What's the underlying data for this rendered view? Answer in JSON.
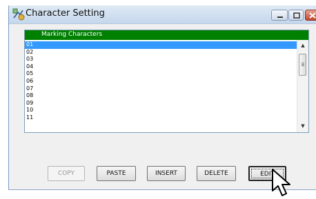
{
  "window": {
    "title": "Character Setting"
  },
  "list": {
    "header": "Marking Characters",
    "rows": [
      "01",
      "02",
      "03",
      "04",
      "05",
      "06",
      "07",
      "08",
      "09",
      "10",
      "11"
    ],
    "selected": "01"
  },
  "buttons": {
    "copy": "COPY",
    "paste": "PASTE",
    "insert": "INSERT",
    "delete": "DELETE",
    "edit": "EDIT"
  },
  "colors": {
    "header_bg": "#008000",
    "selection": "#3399ff"
  },
  "icons": {
    "app": "character-setting-icon",
    "cursor": "arrow-cursor-icon"
  }
}
